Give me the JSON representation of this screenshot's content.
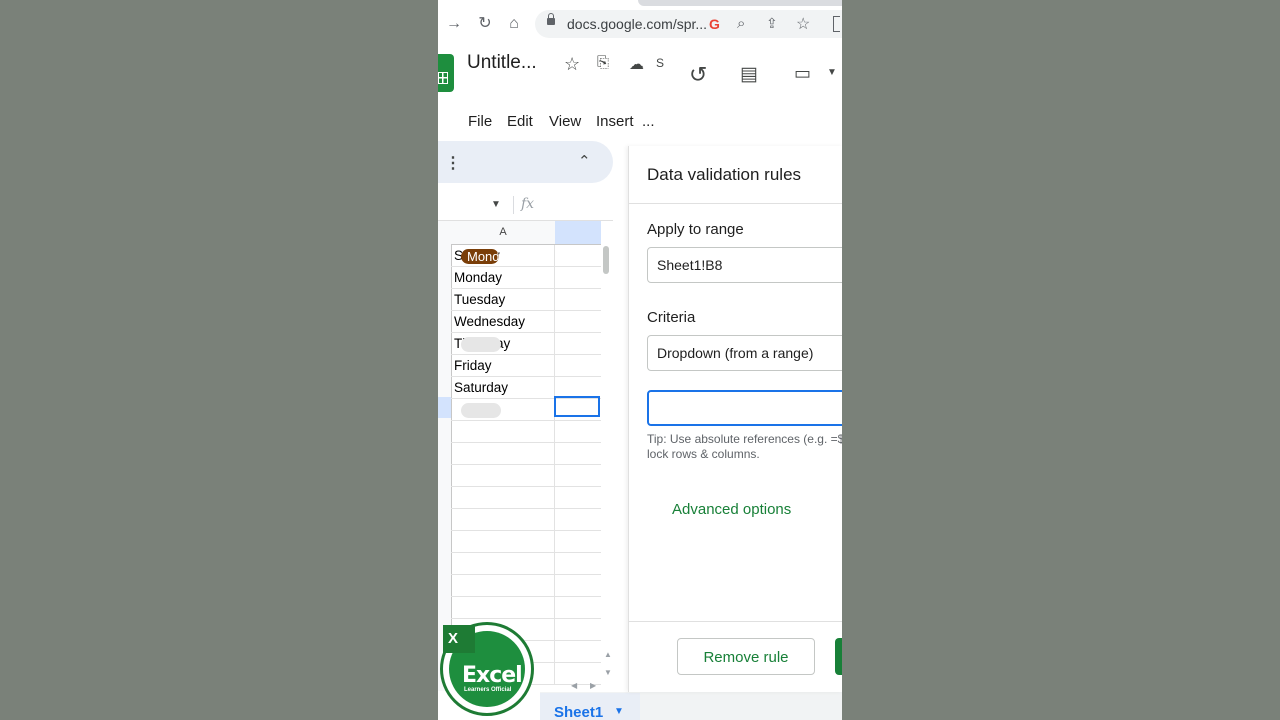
{
  "browser": {
    "url": "docs.google.com/spr...",
    "icons": [
      "forward-icon",
      "reload-icon",
      "home-icon",
      "lock-icon",
      "google-icon",
      "zoom-icon",
      "share-icon",
      "star-icon"
    ]
  },
  "app": {
    "doc_title": "Untitle...",
    "status_letter": "S",
    "menu": [
      "File",
      "Edit",
      "View",
      "Insert",
      "..."
    ],
    "formula_bar_symbol": "fx"
  },
  "grid": {
    "column_a_header": "A",
    "rows": [
      "Sunday",
      "Monday",
      "Tuesday",
      "Wednesday",
      "Thursday",
      "Friday",
      "Saturday"
    ],
    "dropdown_chip": "Monday"
  },
  "panel": {
    "title": "Data validation rules",
    "apply_label": "Apply to range",
    "range_value": "Sheet1!B8",
    "criteria_label": "Criteria",
    "criteria_value": "Dropdown (from a range)",
    "range_input_value": "",
    "tip_line1": "Tip: Use absolute references (e.g. =$",
    "tip_line2": "lock rows & columns.",
    "advanced": "Advanced options",
    "remove_button": "Remove rule"
  },
  "sheet_tab": "Sheet1",
  "watermark": {
    "letter": "X",
    "name": "Excel",
    "tagline": "Learners Official"
  },
  "colors": {
    "accent_green": "#188038",
    "selection_blue": "#1a73e8",
    "chip_brown": "#7a3e08"
  }
}
